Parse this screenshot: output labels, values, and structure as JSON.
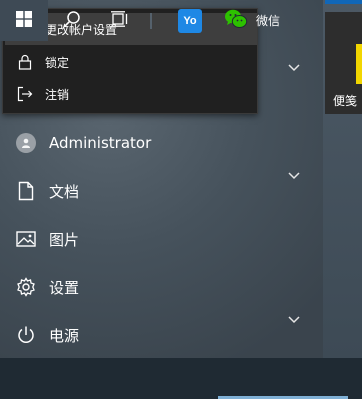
{
  "popup": {
    "items": [
      {
        "label": "更改帐户设置",
        "icon": "user-settings-icon"
      },
      {
        "label": "锁定",
        "icon": "lock-icon"
      },
      {
        "label": "注销",
        "icon": "sign-out-icon"
      }
    ]
  },
  "nav": {
    "user": {
      "label": "Administrator",
      "icon": "avatar-icon"
    },
    "items": [
      {
        "label": "文档",
        "icon": "document-icon"
      },
      {
        "label": "图片",
        "icon": "pictures-icon"
      },
      {
        "label": "设置",
        "icon": "gear-icon"
      },
      {
        "label": "电源",
        "icon": "power-icon"
      }
    ]
  },
  "tiles": {
    "sticky_notes": {
      "label": "便笺"
    }
  },
  "taskbar": {
    "wechat_label": "微信",
    "app1_icon_text": "Yo"
  },
  "colors": {
    "taskbar": "#1f2a33",
    "popup": "#202020",
    "accent_blue": "#1167b8",
    "wechat_green": "#2dc100"
  }
}
